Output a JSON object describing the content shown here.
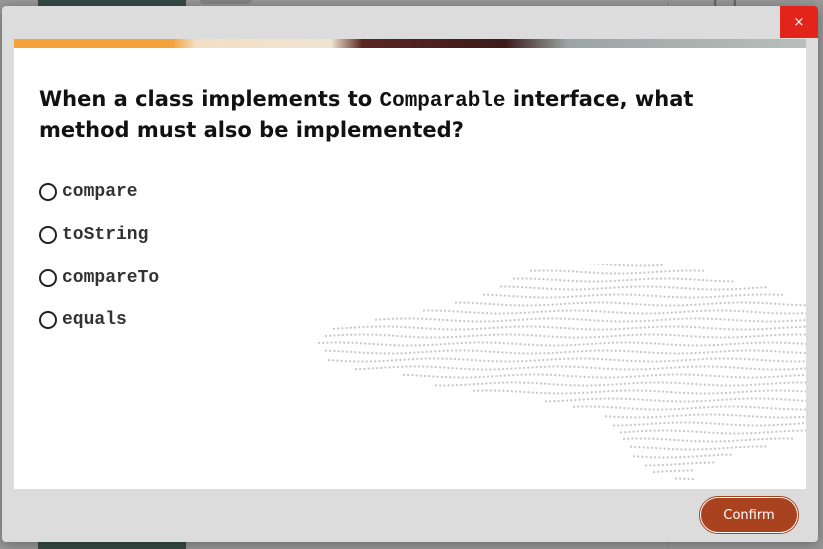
{
  "modal": {
    "close_label": "×",
    "question": {
      "before": "When a class implements to ",
      "code": "Comparable",
      "after": " interface, what method must also be implemented?"
    },
    "options": [
      {
        "label": "compare",
        "selected": false
      },
      {
        "label": "toString",
        "selected": false
      },
      {
        "label": "compareTo",
        "selected": false
      },
      {
        "label": "equals",
        "selected": false
      }
    ],
    "confirm_label": "Confirm"
  },
  "colors": {
    "close_button": "#e3241b",
    "confirm_button": "#a9421f",
    "banner_orange": "#f4a23a"
  }
}
